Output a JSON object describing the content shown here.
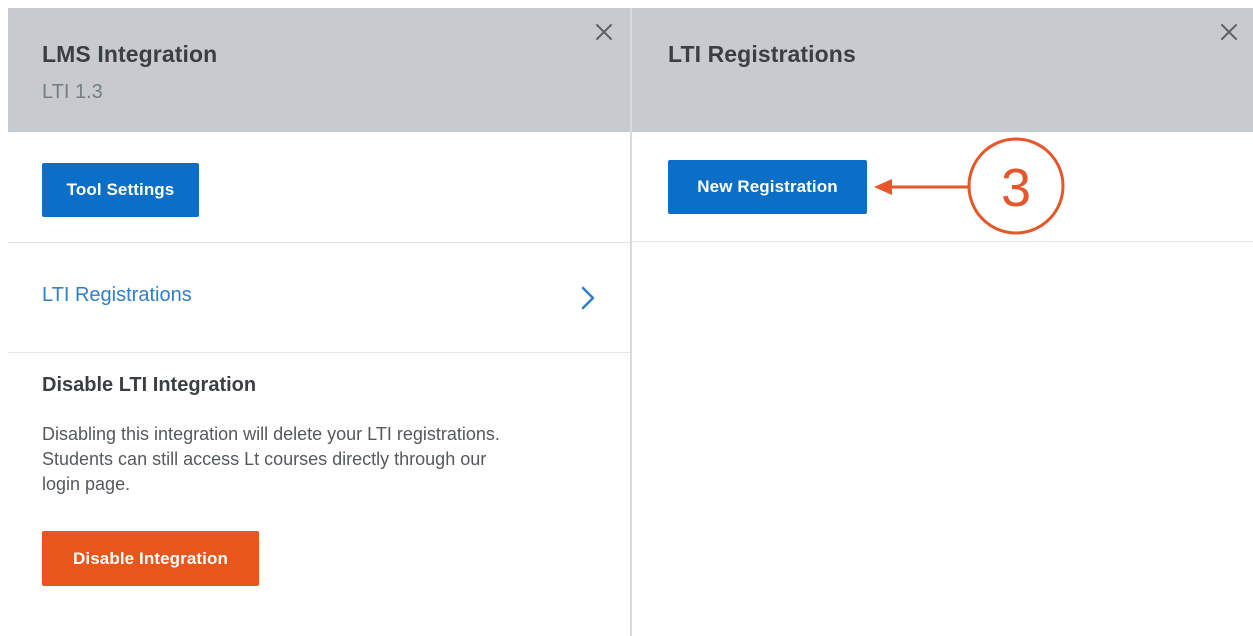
{
  "left_panel": {
    "title": "LMS Integration",
    "subtitle": "LTI 1.3",
    "tool_settings_label": "Tool Settings",
    "nav_item_label": "LTI Registrations",
    "disable_heading": "Disable LTI Integration",
    "disable_text_line1": "Disabling this integration will delete your LTI registrations.",
    "disable_text_line2": "Students can still access Lt courses directly through our",
    "disable_text_line3": "login page.",
    "disable_button_label": "Disable Integration"
  },
  "right_panel": {
    "title": "LTI Registrations",
    "new_registration_label": "New Registration"
  },
  "annotation": {
    "step_number": "3",
    "color": "#e5572a"
  },
  "icons": {
    "close": "close-icon",
    "chevron": "chevron-right-icon"
  },
  "colors": {
    "header_bg": "#c7cbcf",
    "primary_button": "#0b6fc7",
    "danger_button": "#e9561c",
    "link": "#2f7fc9"
  }
}
